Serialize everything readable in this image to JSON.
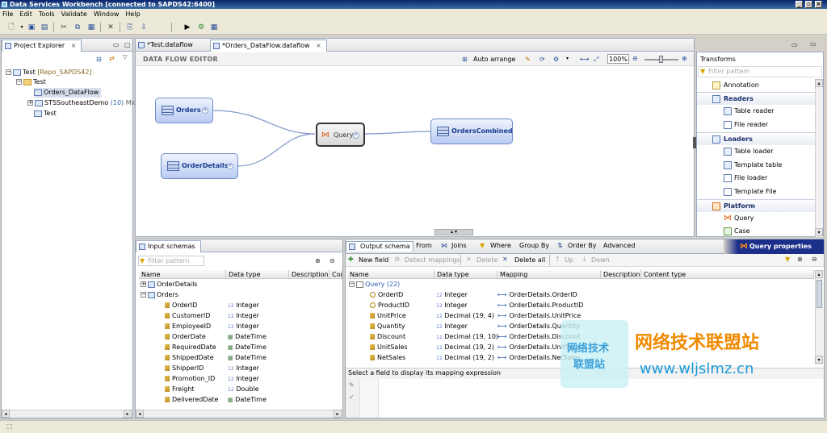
{
  "window": {
    "title": "Data Services Workbench [connected to SAPDS42:6400]"
  },
  "menu": [
    "File",
    "Edit",
    "Tools",
    "Validate",
    "Window",
    "Help"
  ],
  "project_explorer": {
    "tab_label": "Project Explorer",
    "tree": {
      "root_label": "Test",
      "root_repo": "[Repo_SAPDS42]",
      "folder": "Test",
      "selected": "Orders_DataFlow",
      "demo_label": "STSSoutheastDemo",
      "demo_count": "(10)",
      "demo_suffix": "Mic",
      "item_test": "Test"
    }
  },
  "editor": {
    "tabs": [
      "*Test.dataflow",
      "*Orders_DataFlow.dataflow"
    ],
    "header": "DATA FLOW EDITOR",
    "auto_arrange": "Auto arrange",
    "zoom": "100%",
    "nodes": {
      "orders": "Orders",
      "order_details": "OrderDetails",
      "query": "Query",
      "orders_combined": "OrdersCombined"
    }
  },
  "transforms": {
    "title": "Transforms",
    "filter_placeholder": "Filter pattern",
    "annotation": "Annotation",
    "readers": {
      "label": "Readers",
      "items": [
        "Table reader",
        "File reader"
      ]
    },
    "loaders": {
      "label": "Loaders",
      "items": [
        "Table loader",
        "Template table",
        "File loader",
        "Template File"
      ]
    },
    "platform": {
      "label": "Platform",
      "items": [
        "Query",
        "Case"
      ]
    }
  },
  "input_schemas": {
    "tab_label": "Input schemas",
    "filter_placeholder": "Filter pattern",
    "columns": [
      "Name",
      "Data type",
      "Description",
      "Con"
    ],
    "tables": [
      "OrderDetails",
      "Orders"
    ],
    "fields": [
      {
        "name": "OrderID",
        "type": "Integer",
        "icon": "12"
      },
      {
        "name": "CustomerID",
        "type": "Integer",
        "icon": "12"
      },
      {
        "name": "EmployeeID",
        "type": "Integer",
        "icon": "12"
      },
      {
        "name": "OrderDate",
        "type": "DateTime",
        "icon": "dt"
      },
      {
        "name": "RequiredDate",
        "type": "DateTime",
        "icon": "dt"
      },
      {
        "name": "ShippedDate",
        "type": "DateTime",
        "icon": "dt"
      },
      {
        "name": "ShipperID",
        "type": "Integer",
        "icon": "12"
      },
      {
        "name": "Promotion_ID",
        "type": "Integer",
        "icon": "12"
      },
      {
        "name": "Freight",
        "type": "Double",
        "icon": "12"
      },
      {
        "name": "DeliveredDate",
        "type": "DateTime",
        "icon": "dt"
      }
    ]
  },
  "output_schema": {
    "tabs": [
      "Output schema",
      "From",
      "Joins",
      "Where",
      "Group By",
      "Order By",
      "Advanced"
    ],
    "query_properties": "Query properties",
    "toolbar": {
      "new_field": "New field",
      "detect_mappings": "Detect mappings",
      "delete": "Delete",
      "delete_all": "Delete all",
      "up": "Up",
      "down": "Down"
    },
    "columns": [
      "Name",
      "Data type",
      "Mapping",
      "Description",
      "Content type"
    ],
    "query_label": "Query",
    "query_count": "(22)",
    "rows": [
      {
        "name": "OrderID",
        "type": "Integer",
        "mapping": "OrderDetails.OrderID",
        "key": true
      },
      {
        "name": "ProductID",
        "type": "Integer",
        "mapping": "OrderDetails.ProductID",
        "key": true
      },
      {
        "name": "UnitPrice",
        "type": "Decimal (19, 4)",
        "mapping": "OrderDetails.UnitPrice",
        "key": false
      },
      {
        "name": "Quantity",
        "type": "Integer",
        "mapping": "OrderDetails.Quantity",
        "key": false
      },
      {
        "name": "Discount",
        "type": "Decimal (19, 10)",
        "mapping": "OrderDetails.Discount",
        "key": false
      },
      {
        "name": "UnitSales",
        "type": "Decimal (19, 2)",
        "mapping": "OrderDetails.UnitSales",
        "key": false
      },
      {
        "name": "NetSales",
        "type": "Decimal (19, 2)",
        "mapping": "OrderDetails.NetSales",
        "key": false
      }
    ],
    "mapping_hint": "Select a field to display its mapping expression"
  },
  "watermark": {
    "box_line1": "网络技术",
    "box_line2": "联盟站",
    "title": "网络技术联盟站",
    "url": "www.wljslmz.cn"
  },
  "colors": {
    "title_bar": "#0a246a",
    "node_border": "#6f8cc8",
    "query_properties_bg": "#1b2f8a",
    "watermark_orange": "#f08a00",
    "watermark_blue": "#1e9bd7"
  }
}
